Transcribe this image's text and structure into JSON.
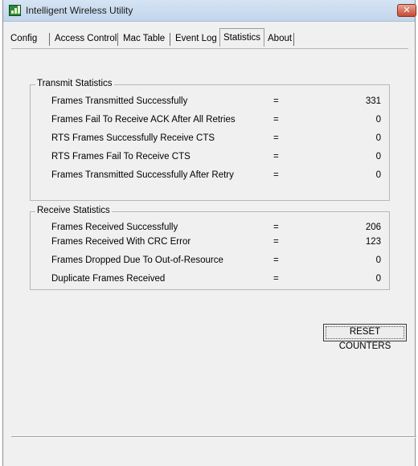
{
  "window": {
    "title": "Intelligent Wireless Utility",
    "close_glyph": "✕"
  },
  "tabs": [
    {
      "label": "Config"
    },
    {
      "label": "Access Control"
    },
    {
      "label": "Mac Table"
    },
    {
      "label": "Event Log"
    },
    {
      "label": "Statistics",
      "active": true
    },
    {
      "label": "About"
    }
  ],
  "transmit": {
    "title": "Transmit Statistics",
    "rows": [
      {
        "label": "Frames Transmitted Successfully",
        "eq": "=",
        "value": "331"
      },
      {
        "label": "Frames Fail To Receive ACK After All Retries",
        "eq": "=",
        "value": "0"
      },
      {
        "label": "RTS Frames Successfully Receive CTS",
        "eq": "=",
        "value": "0"
      },
      {
        "label": "RTS Frames Fail To Receive CTS",
        "eq": "=",
        "value": "0"
      },
      {
        "label": "Frames Transmitted Successfully After Retry",
        "eq": "=",
        "value": "0"
      }
    ]
  },
  "receive": {
    "title": "Receive Statistics",
    "rows": [
      {
        "label": "Frames Received Successfully",
        "eq": "=",
        "value": "206"
      },
      {
        "label": "Frames Received With CRC Error",
        "eq": "=",
        "value": "123"
      },
      {
        "label": "Frames Dropped Due To Out-of-Resource",
        "eq": "=",
        "value": "0"
      },
      {
        "label": "Duplicate Frames Received",
        "eq": "=",
        "value": "0"
      }
    ]
  },
  "reset_button": {
    "label": "RESET COUNTERS"
  },
  "colors": {
    "titlebar": "#c8dbef",
    "close": "#c54a32",
    "panel": "#f0f0f0"
  }
}
